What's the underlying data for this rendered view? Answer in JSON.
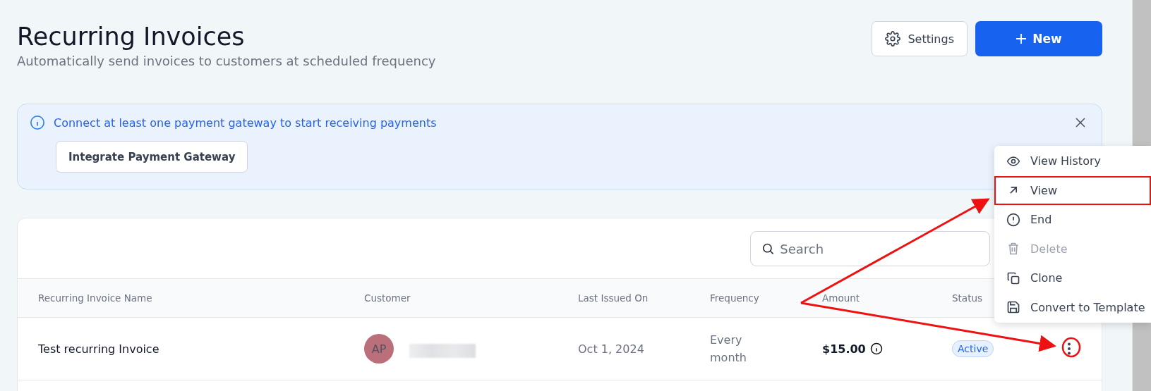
{
  "header": {
    "title": "Recurring Invoices",
    "subtitle": "Automatically send invoices to customers at scheduled frequency",
    "buttons": [
      {
        "kind": "settings",
        "label": "Settings"
      },
      {
        "kind": "new",
        "label": "New"
      }
    ]
  },
  "banner": {
    "message": "Connect at least one payment gateway to start receiving payments",
    "button": "Integrate Payment Gateway"
  },
  "search": {
    "placeholder": "Search"
  },
  "table": {
    "columns": [
      "Recurring Invoice Name",
      "Customer",
      "Last Issued On",
      "Frequency",
      "Amount",
      "Status"
    ],
    "rows": [
      {
        "name": "Test recurring Invoice",
        "customer_initials": "AP",
        "color": "#bb6f7a",
        "last_issued": "Oct 1, 2024",
        "frequency": "Every month",
        "amount": "$15.00",
        "status": "Active"
      }
    ]
  },
  "menu": {
    "items": [
      {
        "kind": "eye",
        "label": "View History",
        "disabled": false,
        "highlighted": false
      },
      {
        "kind": "arrow",
        "label": "View",
        "disabled": false,
        "highlighted": true
      },
      {
        "kind": "alert",
        "label": "End",
        "disabled": false,
        "highlighted": false
      },
      {
        "kind": "trash",
        "label": "Delete",
        "disabled": true,
        "highlighted": false
      },
      {
        "kind": "copy",
        "label": "Clone",
        "disabled": false,
        "highlighted": false
      },
      {
        "kind": "save",
        "label": "Convert to Template",
        "disabled": false,
        "highlighted": false
      }
    ]
  }
}
